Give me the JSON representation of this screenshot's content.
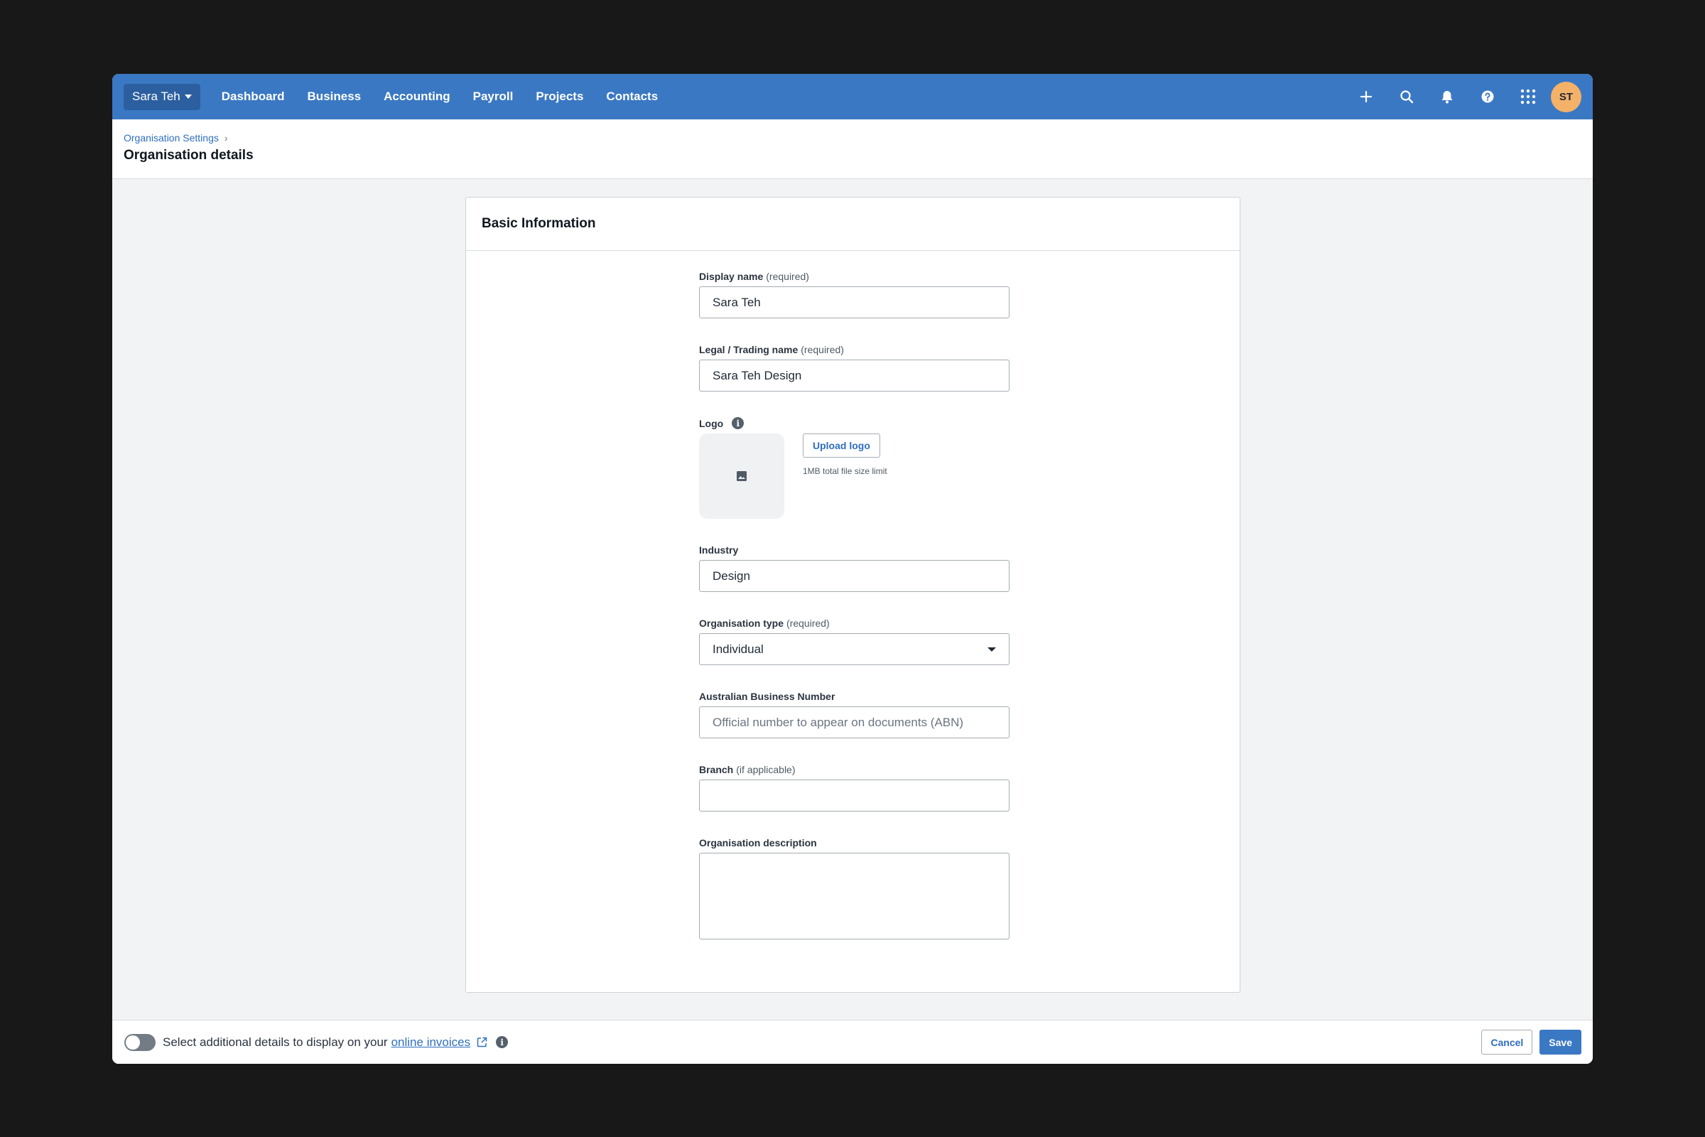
{
  "nav": {
    "org_name": "Sara Teh",
    "links": [
      "Dashboard",
      "Business",
      "Accounting",
      "Payroll",
      "Projects",
      "Contacts"
    ],
    "avatar_initials": "ST",
    "icons": [
      "plus-icon",
      "search-icon",
      "bell-icon",
      "help-icon",
      "apps-grid-icon"
    ]
  },
  "header": {
    "breadcrumb": "Organisation Settings",
    "title": "Organisation details"
  },
  "card": {
    "title": "Basic Information",
    "fields": {
      "display_name": {
        "label": "Display name",
        "note": "(required)",
        "value": "Sara Teh"
      },
      "legal_name": {
        "label": "Legal / Trading name",
        "note": "(required)",
        "value": "Sara Teh Design"
      },
      "logo": {
        "label": "Logo",
        "upload_label": "Upload logo",
        "hint": "1MB total file size limit"
      },
      "industry": {
        "label": "Industry",
        "value": "Design"
      },
      "org_type": {
        "label": "Organisation type",
        "note": "(required)",
        "value": "Individual"
      },
      "abn": {
        "label": "Australian Business Number",
        "placeholder": "Official number to appear on documents (ABN)"
      },
      "branch": {
        "label": "Branch",
        "note": "(if applicable)",
        "value": ""
      },
      "description": {
        "label": "Organisation description",
        "value": ""
      }
    }
  },
  "footer": {
    "toggle_text": "Select additional details to display on your",
    "link_text": "online invoices",
    "cancel_label": "Cancel",
    "save_label": "Save"
  },
  "colors": {
    "brand": "#3a78c3",
    "avatar": "#f4b168"
  }
}
